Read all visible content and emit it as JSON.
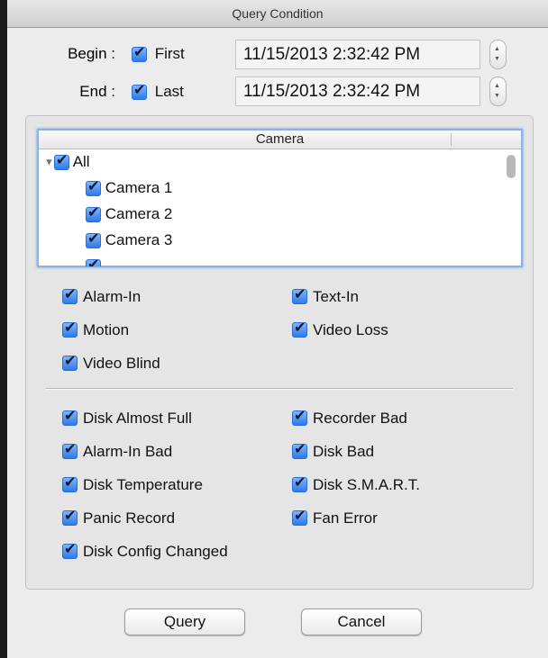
{
  "window": {
    "title": "Query Condition"
  },
  "range": {
    "begin": {
      "label": "Begin :",
      "check_label": "First",
      "value": "11/15/2013   2:32:42  PM"
    },
    "end": {
      "label": "End :",
      "check_label": "Last",
      "value": "11/15/2013   2:32:42  PM"
    }
  },
  "cameras": {
    "header": "Camera",
    "items": [
      {
        "label": "All",
        "indent": 0,
        "expanded": true
      },
      {
        "label": "Camera 1",
        "indent": 1
      },
      {
        "label": "Camera 2",
        "indent": 1
      },
      {
        "label": "Camera 3",
        "indent": 1
      }
    ]
  },
  "events": {
    "alarm_in": "Alarm-In",
    "text_in": "Text-In",
    "motion": "Motion",
    "video_loss": "Video Loss",
    "video_blind": "Video Blind"
  },
  "system_events": {
    "disk_almost_full": "Disk Almost Full",
    "recorder_bad": "Recorder Bad",
    "alarm_in_bad": "Alarm-In Bad",
    "disk_bad": "Disk Bad",
    "disk_temperature": "Disk Temperature",
    "disk_smart": "Disk S.M.A.R.T.",
    "panic_record": "Panic Record",
    "fan_error": "Fan Error",
    "disk_config_changed": "Disk Config Changed"
  },
  "buttons": {
    "query": "Query",
    "cancel": "Cancel"
  }
}
